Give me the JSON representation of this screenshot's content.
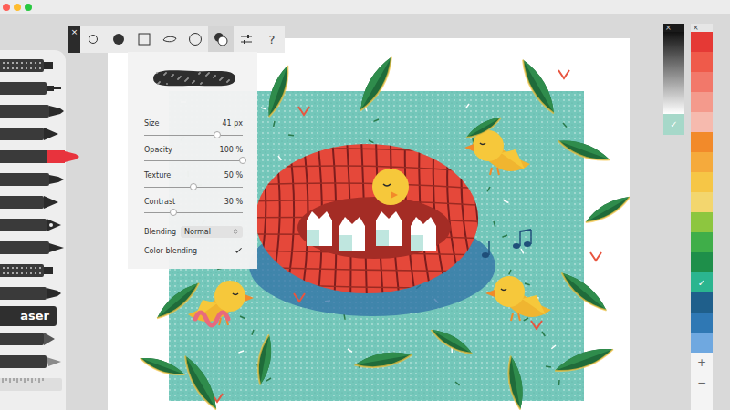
{
  "window": {
    "controls": [
      {
        "color": "#fe5f57"
      },
      {
        "color": "#febc2e"
      },
      {
        "color": "#28c840"
      }
    ]
  },
  "toolbar": {
    "close": "×",
    "tools": [
      {
        "kind": "circle-outline",
        "selected": false
      },
      {
        "kind": "circle-filled",
        "selected": false
      },
      {
        "kind": "square",
        "selected": false
      },
      {
        "kind": "blob",
        "selected": false
      },
      {
        "kind": "circle-large",
        "selected": false
      },
      {
        "kind": "overlap",
        "selected": true
      },
      {
        "kind": "sliders",
        "selected": false
      }
    ],
    "help": "?"
  },
  "brush_panel": {
    "sliders": [
      {
        "label": "Size",
        "reading": "41 px",
        "level": 0.74
      },
      {
        "label": "Opacity",
        "reading": "100 %",
        "level": 1.0
      },
      {
        "label": "Texture",
        "reading": "50 %",
        "level": 0.5
      },
      {
        "label": "Contrast",
        "reading": "30 %",
        "level": 0.3
      }
    ],
    "blending": {
      "label": "Blending",
      "value": "Normal"
    },
    "color_blending": {
      "label": "Color blending",
      "checked": true
    }
  },
  "tool_tray": {
    "tools": [
      {
        "kind": "textured",
        "selected": false
      },
      {
        "kind": "fineliner",
        "selected": false
      },
      {
        "kind": "marker",
        "selected": false
      },
      {
        "kind": "pen",
        "selected": false
      },
      {
        "kind": "marker",
        "selected": true,
        "color": "#e8333d"
      },
      {
        "kind": "brush",
        "selected": false
      },
      {
        "kind": "pen",
        "selected": false
      },
      {
        "kind": "fountain",
        "selected": false
      },
      {
        "kind": "nib",
        "selected": false
      },
      {
        "kind": "textured",
        "selected": false
      },
      {
        "kind": "marker",
        "selected": false
      },
      {
        "kind": "eraser",
        "label": "aser",
        "selected": false
      },
      {
        "kind": "pencil",
        "selected": false
      },
      {
        "kind": "knife",
        "selected": false
      },
      {
        "kind": "ruler",
        "selected": false
      }
    ]
  },
  "gray_panel": {
    "close": "×",
    "current": {
      "color": "#a6d8c9",
      "mark": "✓"
    }
  },
  "color_panel": {
    "close": "×",
    "check": "✓",
    "swatches": [
      {
        "color": "#e53935",
        "selected": false
      },
      {
        "color": "#ef5a4a",
        "selected": false
      },
      {
        "color": "#f2786a",
        "selected": false
      },
      {
        "color": "#f49a8c",
        "selected": false
      },
      {
        "color": "#f6baae",
        "selected": false
      },
      {
        "color": "#f28a2a",
        "selected": false
      },
      {
        "color": "#f5aa3c",
        "selected": false
      },
      {
        "color": "#f6c646",
        "selected": false
      },
      {
        "color": "#f3d66e",
        "selected": false
      },
      {
        "color": "#8dc63f",
        "selected": false
      },
      {
        "color": "#3fae49",
        "selected": false
      },
      {
        "color": "#1e8f4a",
        "selected": false
      },
      {
        "color": "#2bb58f",
        "selected": true
      },
      {
        "color": "#1f5f8b",
        "selected": false
      },
      {
        "color": "#2f78b4",
        "selected": false
      },
      {
        "color": "#6fa8e0",
        "selected": false
      }
    ],
    "add": "+",
    "remove": "−"
  }
}
